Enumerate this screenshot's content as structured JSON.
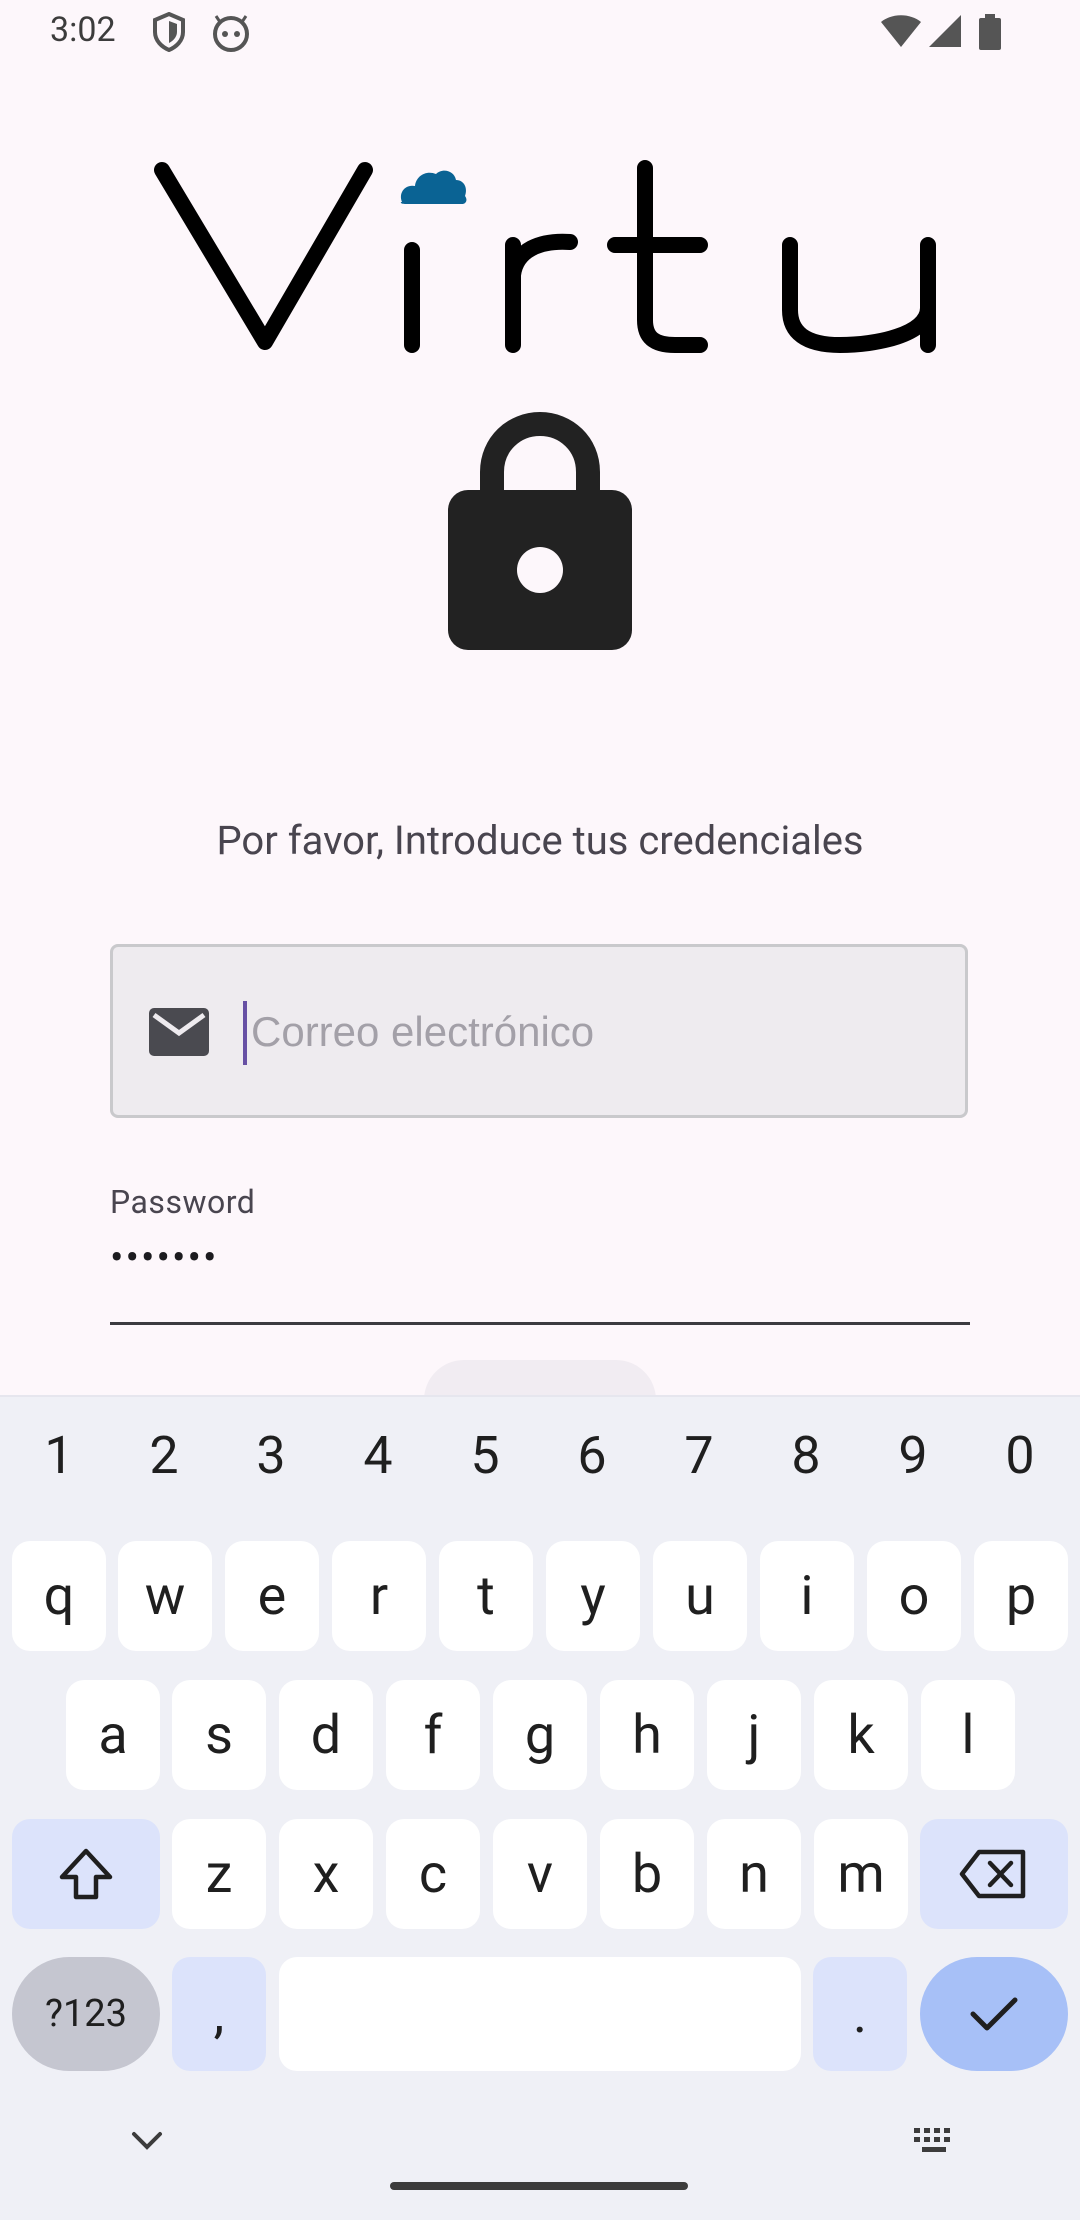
{
  "status_bar": {
    "time": "3:02",
    "icons_left": [
      "shield-icon",
      "android-head-icon"
    ],
    "icons_right": [
      "wifi-icon",
      "cell-signal-icon",
      "battery-icon"
    ]
  },
  "logo": {
    "text": "Virtu",
    "accent_color": "#0a6394"
  },
  "lock_icon": "lock-icon",
  "prompt": "Por favor, Introduce tus credenciales",
  "email": {
    "placeholder": "Correo electrónico",
    "value": "",
    "icon": "mail-icon"
  },
  "password": {
    "label": "Password",
    "value": "•••••••"
  },
  "keyboard": {
    "numbers": [
      "1",
      "2",
      "3",
      "4",
      "5",
      "6",
      "7",
      "8",
      "9",
      "0"
    ],
    "row1": [
      "q",
      "w",
      "e",
      "r",
      "t",
      "y",
      "u",
      "i",
      "o",
      "p"
    ],
    "row2": [
      "a",
      "s",
      "d",
      "f",
      "g",
      "h",
      "j",
      "k",
      "l"
    ],
    "row3": [
      "z",
      "x",
      "c",
      "v",
      "b",
      "n",
      "m"
    ],
    "symbols_label": "?123",
    "comma": ",",
    "period": ".",
    "icons": [
      "shift-icon",
      "backspace-icon",
      "checkmark-icon",
      "chevron-down-icon",
      "keyboard-switch-icon"
    ]
  },
  "colors": {
    "background": "#fdf7fb",
    "accent": "#6750a4",
    "keyboard_bg": "#eff0f6"
  }
}
